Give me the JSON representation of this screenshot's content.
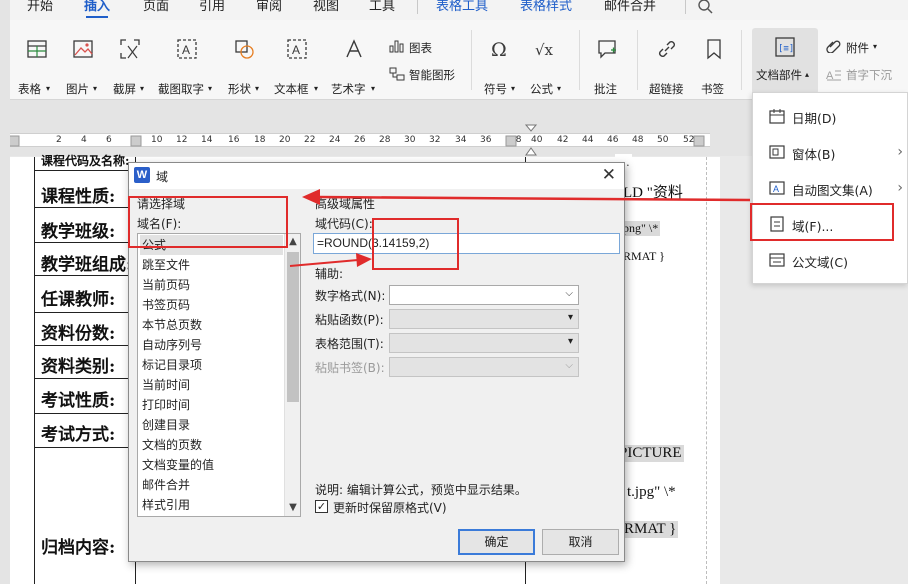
{
  "menubar": {
    "items": [
      "开始",
      "插入",
      "页面",
      "引用",
      "审阅",
      "视图",
      "工具",
      "表格工具",
      "表格样式",
      "邮件合并"
    ],
    "active": "插入",
    "search_icon": "search-icon"
  },
  "ribbon": {
    "buttons": [
      {
        "label": "表格",
        "icon": "table-icon"
      },
      {
        "label": "图片",
        "icon": "picture-icon"
      },
      {
        "label": "截屏",
        "icon": "screenshot-icon"
      },
      {
        "label": "截图取字",
        "icon": "ocr-icon"
      },
      {
        "label": "形状",
        "icon": "shape-icon"
      },
      {
        "label": "文本框",
        "icon": "textbox-icon"
      },
      {
        "label": "艺术字",
        "icon": "wordart-icon"
      },
      {
        "label": "符号",
        "icon": "omega-icon"
      },
      {
        "label": "公式",
        "icon": "formula-icon"
      },
      {
        "label": "批注",
        "icon": "comment-icon"
      },
      {
        "label": "超链接",
        "icon": "link-icon"
      },
      {
        "label": "书签",
        "icon": "bookmark-icon"
      },
      {
        "label": "文档部件",
        "icon": "doc-parts-icon"
      }
    ],
    "chart_label": "图表",
    "smart_art_label": "智能图形",
    "attachment_label": "附件",
    "dropcap_label": "首字下沉"
  },
  "ruler": {
    "numbers": [
      "2",
      "4",
      "6",
      "8",
      "10",
      "12",
      "14",
      "16",
      "18",
      "20",
      "22",
      "24",
      "26",
      "28",
      "30",
      "32",
      "34",
      "36",
      "38",
      "40",
      "42",
      "44",
      "46",
      "48",
      "50",
      "52"
    ]
  },
  "document": {
    "rows": [
      "课程代码及名称:",
      "课程性质:",
      "教学班级:",
      "教学班组成:",
      "任课教师:",
      "资料份数:",
      "资料类别:",
      "考试性质:",
      "考试方式:",
      "归档内容:"
    ],
    "field_codes": [
      "LD \"资料",
      "png\" \\*",
      "RMAT }",
      "PICTURE",
      "t.jpg\"  \\*",
      "RMAT }"
    ]
  },
  "dropdown": {
    "items": [
      {
        "label": "日期(D)",
        "icon": "calendar-icon",
        "submenu": false
      },
      {
        "label": "窗体(B)",
        "icon": "form-icon",
        "submenu": true
      },
      {
        "label": "自动图文集(A)",
        "icon": "autotext-icon",
        "submenu": true
      },
      {
        "label": "域(F)...",
        "icon": "field-icon",
        "submenu": false
      },
      {
        "label": "公文域(C)",
        "icon": "doc-field-icon",
        "submenu": false
      }
    ]
  },
  "dialog": {
    "title": "域",
    "logo": "W",
    "left_group": "请选择域",
    "field_names_label": "域名(F):",
    "field_names": [
      "公式",
      "跳至文件",
      "当前页码",
      "书签页码",
      "本节总页数",
      "自动序列号",
      "标记目录项",
      "当前时间",
      "打印时间",
      "创建目录",
      "文档的页数",
      "文档变量的值",
      "邮件合并",
      "样式引用"
    ],
    "selected": "公式",
    "right_group": "高级域属性",
    "field_code_label": "域代码(C):",
    "field_code_value": "=ROUND(3.14159,2)",
    "aux_label": "辅助:",
    "number_format_label": "数字格式(N):",
    "paste_function_label": "粘贴函数(P):",
    "table_range_label": "表格范围(T):",
    "paste_bookmark_label": "粘贴书签(B):",
    "description": "说明: 编辑计算公式，预览中显示结果。",
    "keep_format_label": "更新时保留原格式(V)",
    "keep_format_checked": true,
    "ok_label": "确定",
    "cancel_label": "取消"
  }
}
